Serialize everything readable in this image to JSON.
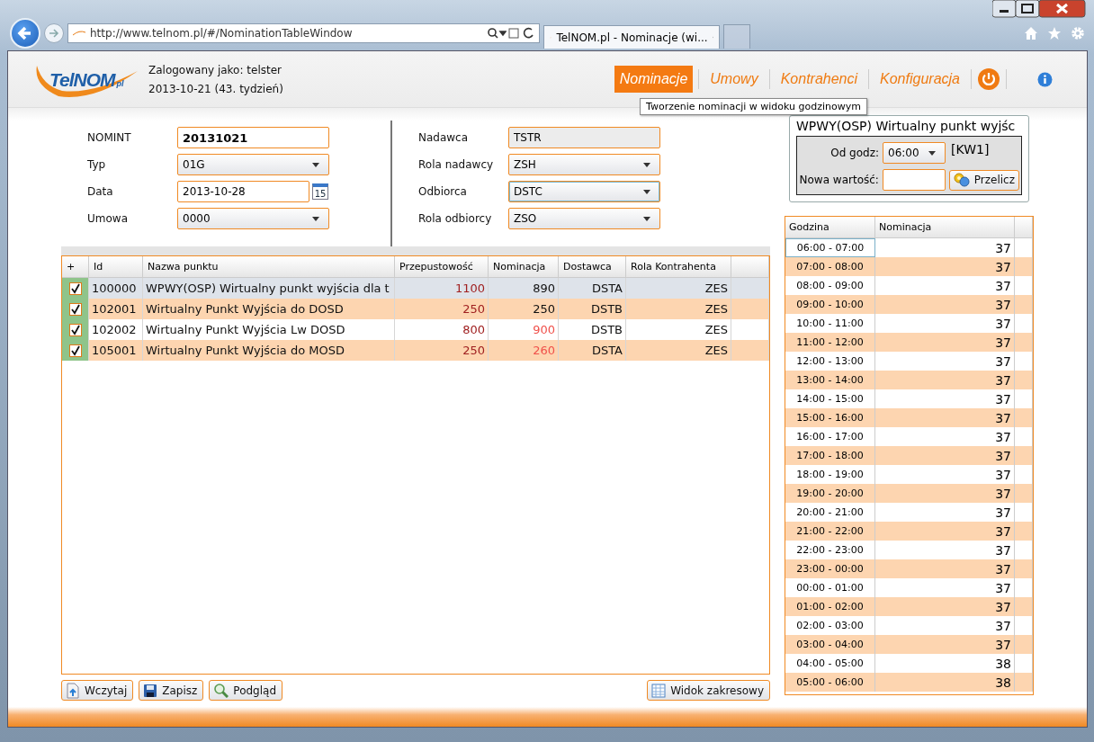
{
  "browser": {
    "address": "http://www.telnom.pl/#/NominationTableWindow",
    "tab_title": "TelNOM.pl - Nominacje (wi..."
  },
  "header": {
    "logo": {
      "name": "TelNOM",
      "suffix": "pl"
    },
    "user_label": "Zalogowany jako: telster",
    "date_label": "2013-10-21 (43. tydzień)",
    "nav": [
      {
        "label": "Nominacje",
        "selected": true
      },
      {
        "label": "Umowy",
        "selected": false
      },
      {
        "label": "Kontrahenci",
        "selected": false
      },
      {
        "label": "Konfiguracja",
        "selected": false
      }
    ],
    "tooltip": "Tworzenie nominacji w widoku godzinowym"
  },
  "form": {
    "left": [
      {
        "label": "NOMINT",
        "kind": "text",
        "value": "20131021",
        "bold": true
      },
      {
        "label": "Typ",
        "kind": "dropdown",
        "value": "01G"
      },
      {
        "label": "Data",
        "kind": "date",
        "value": "2013-10-28",
        "day": "15"
      },
      {
        "label": "Umowa",
        "kind": "dropdown",
        "value": "0000"
      }
    ],
    "right": [
      {
        "label": "Nadawca",
        "kind": "readonly",
        "value": "TSTR"
      },
      {
        "label": "Rola nadawcy",
        "kind": "dropdown",
        "value": "ZSH"
      },
      {
        "label": "Odbiorca",
        "kind": "dropdown",
        "value": "DSTC",
        "focused": true
      },
      {
        "label": "Rola odbiorcy",
        "kind": "dropdown",
        "value": "ZSO"
      }
    ]
  },
  "table": {
    "columns": [
      "+",
      "Id",
      "Nazwa punktu",
      "Przepustowość",
      "Nominacja",
      "Dostawca",
      "Rola Kontrahenta"
    ],
    "rows": [
      {
        "checked": true,
        "selected": true,
        "exceeded": false,
        "id": "100000",
        "name": "WPWY(OSP) Wirtualny punkt wyjścia dla t",
        "capacity": "1100",
        "nomination": "890",
        "supplier": "DSTA",
        "role": "ZES"
      },
      {
        "checked": true,
        "selected": false,
        "exceeded": false,
        "id": "102001",
        "name": "Wirtualny Punkt Wyjścia do DOSD",
        "capacity": "250",
        "nomination": "250",
        "supplier": "DSTB",
        "role": "ZES"
      },
      {
        "checked": true,
        "selected": false,
        "exceeded": true,
        "id": "102002",
        "name": "Wirtualny Punkt Wyjścia Lw DOSD",
        "capacity": "800",
        "nomination": "900",
        "supplier": "DSTB",
        "role": "ZES"
      },
      {
        "checked": true,
        "selected": false,
        "exceeded": true,
        "id": "105001",
        "name": "Wirtualny Punkt Wyjścia do MOSD",
        "capacity": "250",
        "nomination": "260",
        "supplier": "DSTA",
        "role": "ZES"
      }
    ]
  },
  "buttons": [
    {
      "label": "Wczytaj",
      "kind": "load"
    },
    {
      "label": "Zapisz",
      "kind": "save"
    },
    {
      "label": "Podgląd",
      "kind": "preview"
    }
  ],
  "range_button": "Widok zakresowy",
  "point_panel": {
    "title": "WPWY(OSP) Wirtualny punkt wyjśc",
    "from_label": "Od godz:",
    "from_value": "06:00",
    "code": "[KW1]",
    "new_value_label": "Nowa wartość:",
    "recalc_button": "Przelicz"
  },
  "hourly": {
    "columns": [
      "Godzina",
      "Nominacja"
    ],
    "rows": [
      {
        "hour": "06:00 - 07:00",
        "value": "37",
        "selected": true
      },
      {
        "hour": "07:00 - 08:00",
        "value": "37",
        "selected": false
      },
      {
        "hour": "08:00 - 09:00",
        "value": "37",
        "selected": false
      },
      {
        "hour": "09:00 - 10:00",
        "value": "37",
        "selected": false
      },
      {
        "hour": "10:00 - 11:00",
        "value": "37",
        "selected": false
      },
      {
        "hour": "11:00 - 12:00",
        "value": "37",
        "selected": false
      },
      {
        "hour": "12:00 - 13:00",
        "value": "37",
        "selected": false
      },
      {
        "hour": "13:00 - 14:00",
        "value": "37",
        "selected": false
      },
      {
        "hour": "14:00 - 15:00",
        "value": "37",
        "selected": false
      },
      {
        "hour": "15:00 - 16:00",
        "value": "37",
        "selected": false
      },
      {
        "hour": "16:00 - 17:00",
        "value": "37",
        "selected": false
      },
      {
        "hour": "17:00 - 18:00",
        "value": "37",
        "selected": false
      },
      {
        "hour": "18:00 - 19:00",
        "value": "37",
        "selected": false
      },
      {
        "hour": "19:00 - 20:00",
        "value": "37",
        "selected": false
      },
      {
        "hour": "20:00 - 21:00",
        "value": "37",
        "selected": false
      },
      {
        "hour": "21:00 - 22:00",
        "value": "37",
        "selected": false
      },
      {
        "hour": "22:00 - 23:00",
        "value": "37",
        "selected": false
      },
      {
        "hour": "23:00 - 00:00",
        "value": "37",
        "selected": false
      },
      {
        "hour": "00:00 - 01:00",
        "value": "37",
        "selected": false
      },
      {
        "hour": "01:00 - 02:00",
        "value": "37",
        "selected": false
      },
      {
        "hour": "02:00 - 03:00",
        "value": "37",
        "selected": false
      },
      {
        "hour": "03:00 - 04:00",
        "value": "37",
        "selected": false
      },
      {
        "hour": "04:00 - 05:00",
        "value": "38",
        "selected": false
      },
      {
        "hour": "05:00 - 06:00",
        "value": "38",
        "selected": false
      }
    ]
  }
}
